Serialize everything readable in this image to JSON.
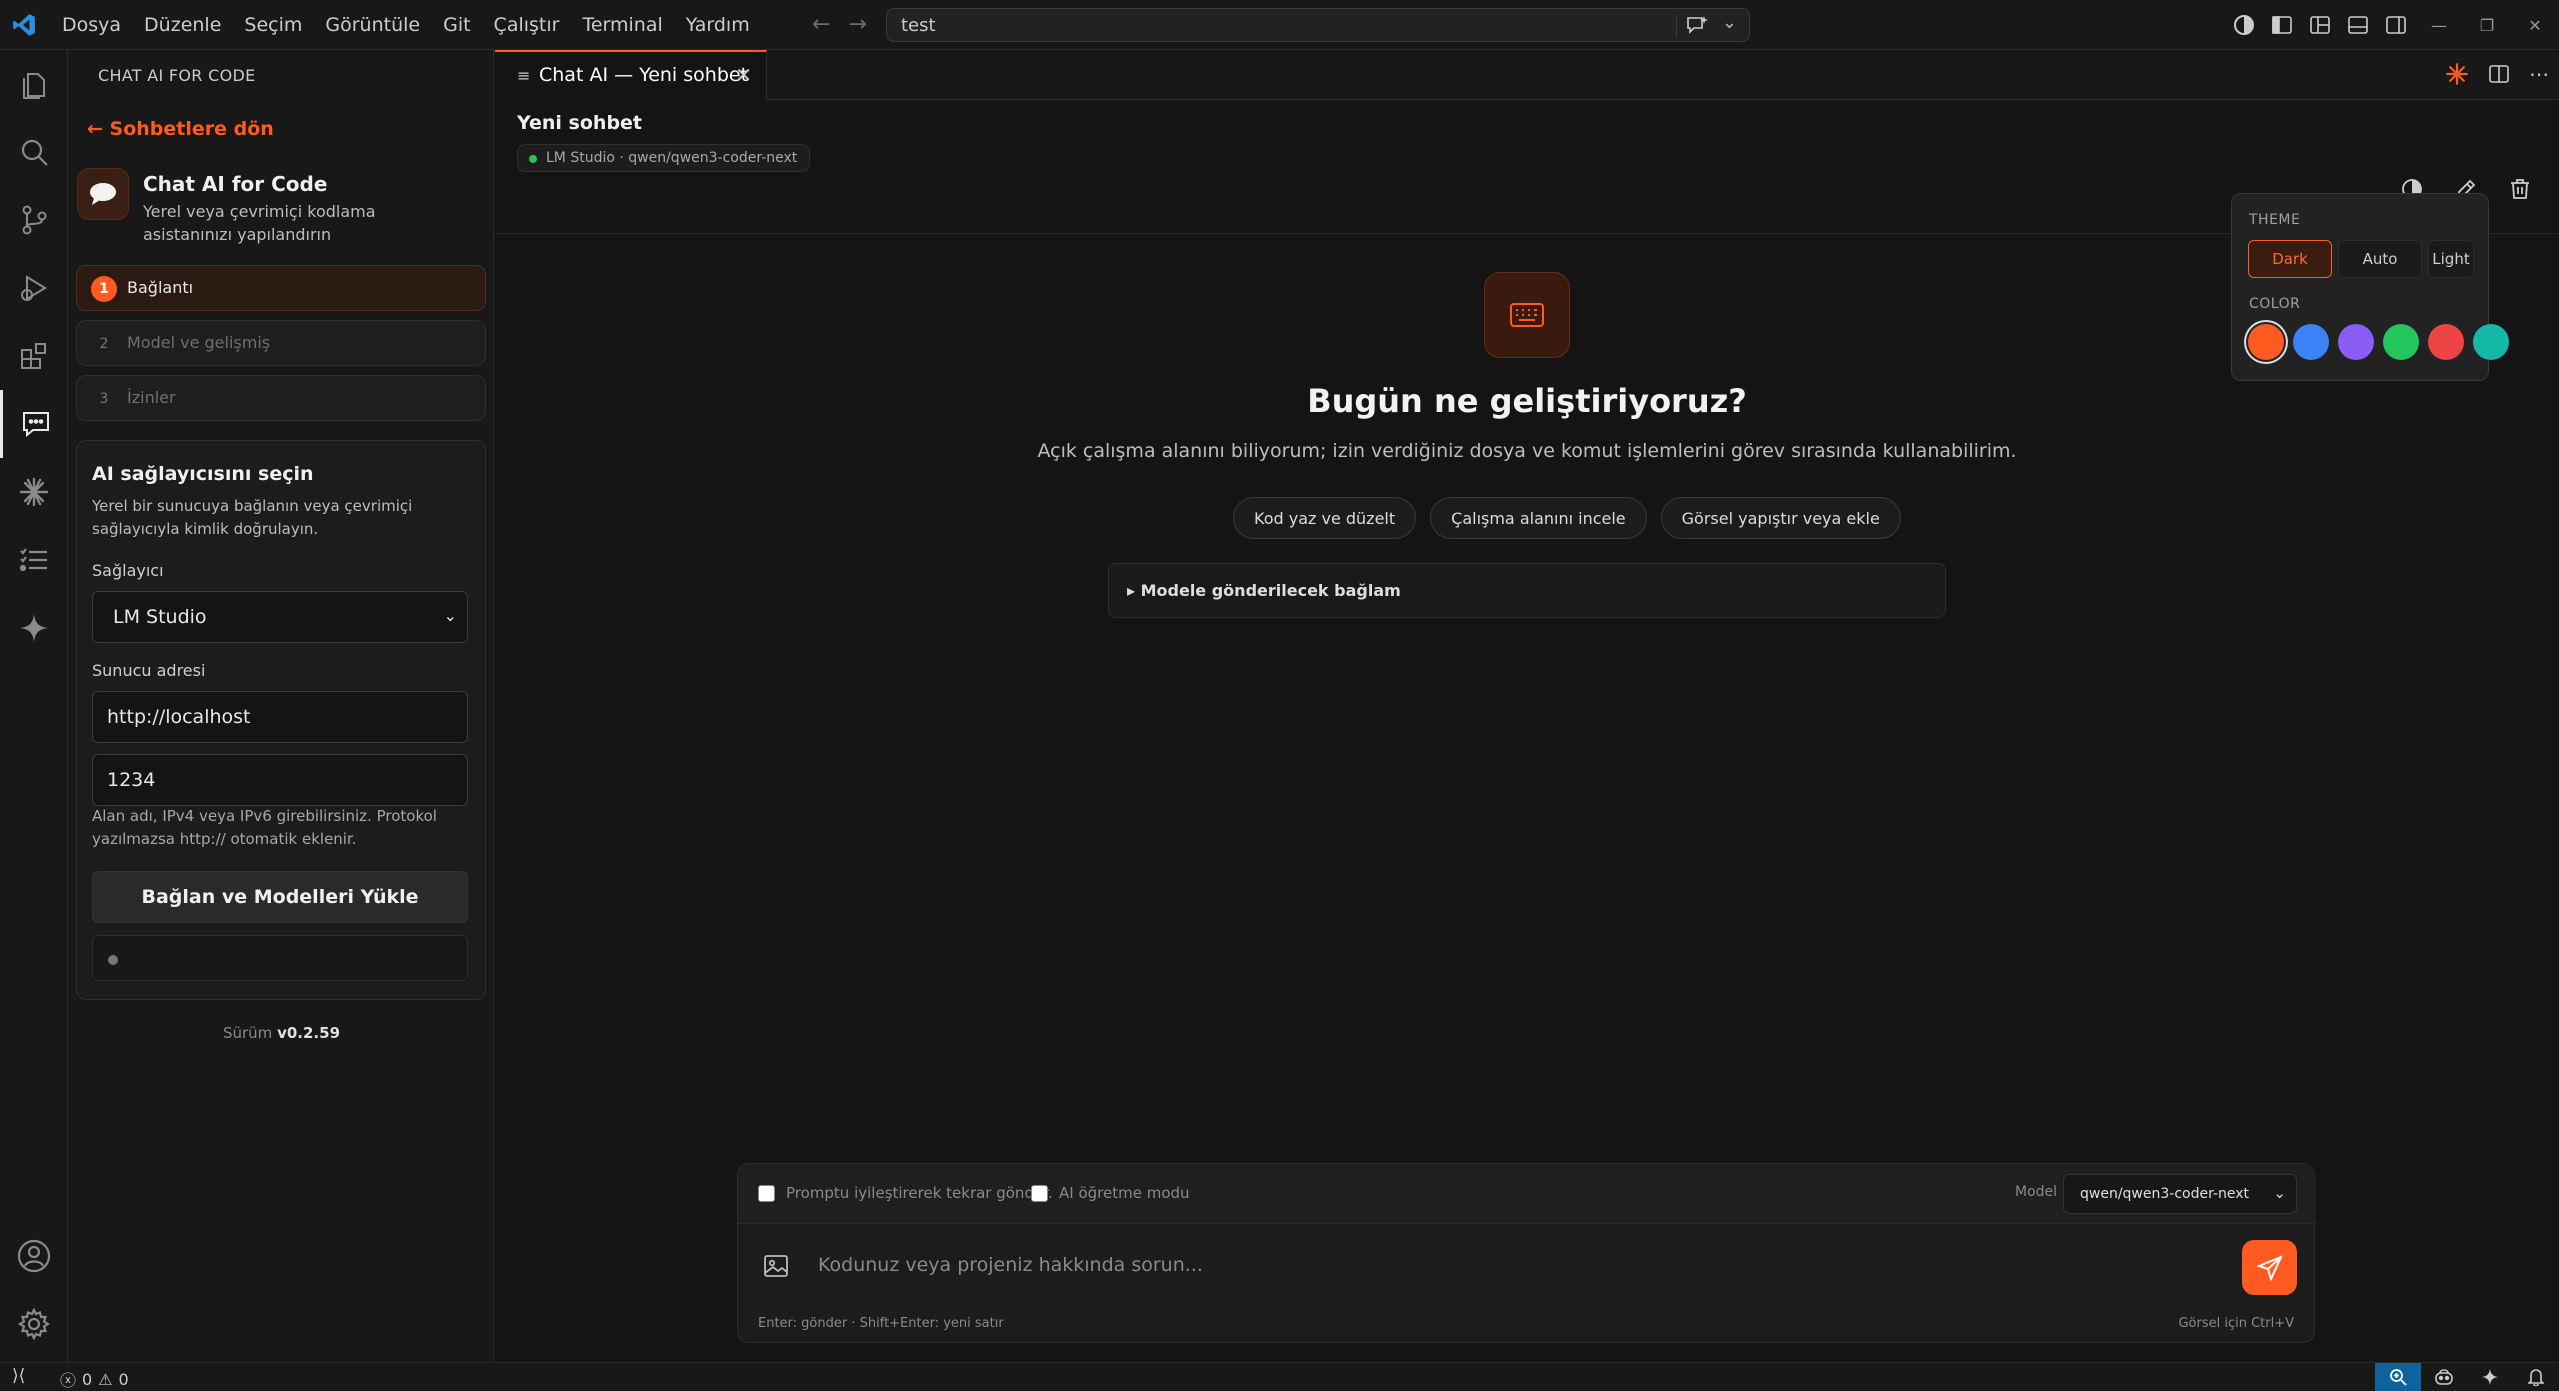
{
  "titlebar": {
    "menu": [
      "Dosya",
      "Düzenle",
      "Seçim",
      "Görüntüle",
      "Git",
      "Çalıştır",
      "Terminal",
      "Yardım"
    ],
    "search_text": "test"
  },
  "sidebar": {
    "header": "CHAT AI FOR CODE",
    "back_link": "← Sohbetlere dön",
    "brand_title": "Chat AI for Code",
    "brand_subtitle": "Yerel veya çevrimiçi kodlama asistanınızı yapılandırın",
    "steps": [
      {
        "num": "1",
        "label": "Bağlantı"
      },
      {
        "num": "2",
        "label": "Model ve gelişmiş"
      },
      {
        "num": "3",
        "label": "İzinler"
      }
    ],
    "card": {
      "title": "AI sağlayıcısını seçin",
      "description": "Yerel bir sunucuya bağlanın veya çevrimiçi sağlayıcıyla kimlik doğrulayın.",
      "provider_label": "Sağlayıcı",
      "provider_value": "LM Studio",
      "server_label": "Sunucu adresi",
      "server_value": "http://localhost",
      "port_value": "1234",
      "hint": "Alan adı, IPv4 veya IPv6 girebilirsiniz. Protokol yazılmazsa http:// otomatik eklenir.",
      "connect_button": "Bağlan ve Modelleri Yükle"
    },
    "version_label": "Sürüm",
    "version_value": "v0.2.59"
  },
  "editor": {
    "tab_label": "Chat AI — Yeni sohbet",
    "chat_title": "Yeni sohbet",
    "model_pill": "LM Studio · qwen/qwen3-coder-next",
    "hero_title": "Bugün ne geliştiriyoruz?",
    "hero_subtitle": "Açık çalışma alanını biliyorum; izin verdiğiniz dosya ve komut işlemlerini görev sırasında kullanabilirim.",
    "chips": [
      "Kod yaz ve düzelt",
      "Çalışma alanını incele",
      "Görsel yapıştır veya ekle"
    ],
    "context_label": "▸ Modele gönderilecek bağlam"
  },
  "theme_popover": {
    "theme_label": "THEME",
    "themes": [
      "Dark",
      "Auto",
      "Light"
    ],
    "selected_theme": "Dark",
    "color_label": "COLOR",
    "colors": [
      "#ff5a1f",
      "#3b82f6",
      "#8b5cf6",
      "#22c55e",
      "#ef4444",
      "#14b8a6"
    ],
    "selected_color": "#ff5a1f"
  },
  "composer": {
    "option1": "Promptu iyileştirerek tekrar gönder.",
    "option2": "AI öğretme modu",
    "model_label": "Model",
    "model_value": "qwen/qwen3-coder-next",
    "placeholder": "Kodunuz veya projeniz hakkında sorun...",
    "hint_left": "Enter: gönder · Shift+Enter: yeni satır",
    "hint_right": "Görsel için Ctrl+V"
  },
  "statusbar": {
    "errors": "0",
    "warnings": "0"
  },
  "colors": {
    "accent": "#ff5a1f",
    "background": "#141414",
    "sidebar": "#181818"
  }
}
